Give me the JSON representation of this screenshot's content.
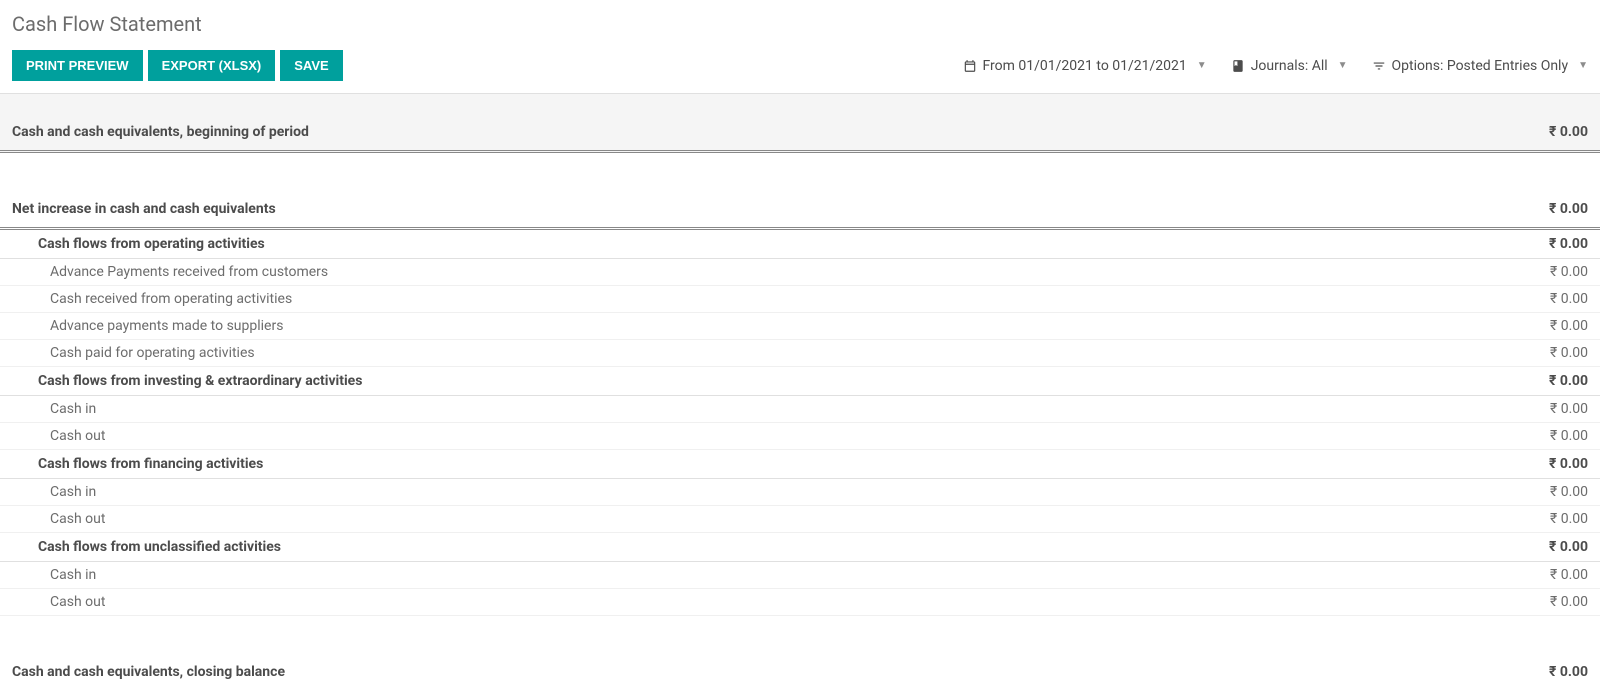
{
  "page": {
    "title": "Cash Flow Statement"
  },
  "toolbar": {
    "print_preview": "PRINT PREVIEW",
    "export_xlsx": "EXPORT (XLSX)",
    "save": "SAVE"
  },
  "filters": {
    "date_range": "From 01/01/2021 to 01/21/2021",
    "journals": "Journals: All",
    "options": "Options: Posted Entries Only"
  },
  "currency_symbol": "₹",
  "sections": {
    "beginning": {
      "label": "Cash and cash equivalents, beginning of period",
      "amount": "₹ 0.00"
    },
    "net_increase": {
      "label": "Net increase in cash and cash equivalents",
      "amount": "₹ 0.00"
    },
    "operating": {
      "label": "Cash flows from operating activities",
      "amount": "₹ 0.00",
      "items": [
        {
          "label": "Advance Payments received from customers",
          "amount": "₹ 0.00"
        },
        {
          "label": "Cash received from operating activities",
          "amount": "₹ 0.00"
        },
        {
          "label": "Advance payments made to suppliers",
          "amount": "₹ 0.00"
        },
        {
          "label": "Cash paid for operating activities",
          "amount": "₹ 0.00"
        }
      ]
    },
    "investing": {
      "label": "Cash flows from investing & extraordinary activities",
      "amount": "₹ 0.00",
      "items": [
        {
          "label": "Cash in",
          "amount": "₹ 0.00"
        },
        {
          "label": "Cash out",
          "amount": "₹ 0.00"
        }
      ]
    },
    "financing": {
      "label": "Cash flows from financing activities",
      "amount": "₹ 0.00",
      "items": [
        {
          "label": "Cash in",
          "amount": "₹ 0.00"
        },
        {
          "label": "Cash out",
          "amount": "₹ 0.00"
        }
      ]
    },
    "unclassified": {
      "label": "Cash flows from unclassified activities",
      "amount": "₹ 0.00",
      "items": [
        {
          "label": "Cash in",
          "amount": "₹ 0.00"
        },
        {
          "label": "Cash out",
          "amount": "₹ 0.00"
        }
      ]
    },
    "closing": {
      "label": "Cash and cash equivalents, closing balance",
      "amount": "₹ 0.00"
    }
  }
}
